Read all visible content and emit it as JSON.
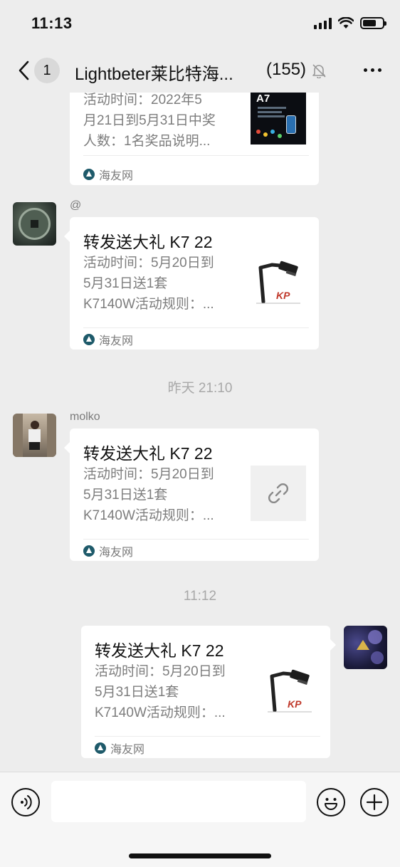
{
  "status_bar": {
    "time": "11:13"
  },
  "nav": {
    "unread_count": "1",
    "title": "Lightbeter莱比特海...",
    "member_count": "(155)"
  },
  "messages": [
    {
      "desc_lines": [
        "活动时间：2022年5",
        "月21日到5月31日中奖",
        "人数：1名奖品说明..."
      ],
      "source": "海友网",
      "thumb_text": "A7"
    },
    {
      "sender": "@",
      "title": "转发送大礼 K7 22",
      "desc_lines": [
        "活动时间：5月20日到",
        "5月31日送1套",
        "K7140W活动规则：..."
      ],
      "source": "海友网"
    },
    {
      "sender": "molko",
      "title": "转发送大礼 K7 22",
      "desc_lines": [
        "活动时间：5月20日到",
        "5月31日送1套",
        "K7140W活动规则：..."
      ],
      "source": "海友网"
    },
    {
      "title": "转发送大礼 K7 22",
      "desc_lines": [
        "活动时间：5月20日到",
        "5月31日送1套",
        "K7140W活动规则：..."
      ],
      "source": "海友网"
    }
  ],
  "timestamps": [
    "昨天 21:10",
    "11:12"
  ],
  "colors": {
    "background": "#ededed",
    "card": "#ffffff",
    "muted_text": "#7d7d7d"
  }
}
